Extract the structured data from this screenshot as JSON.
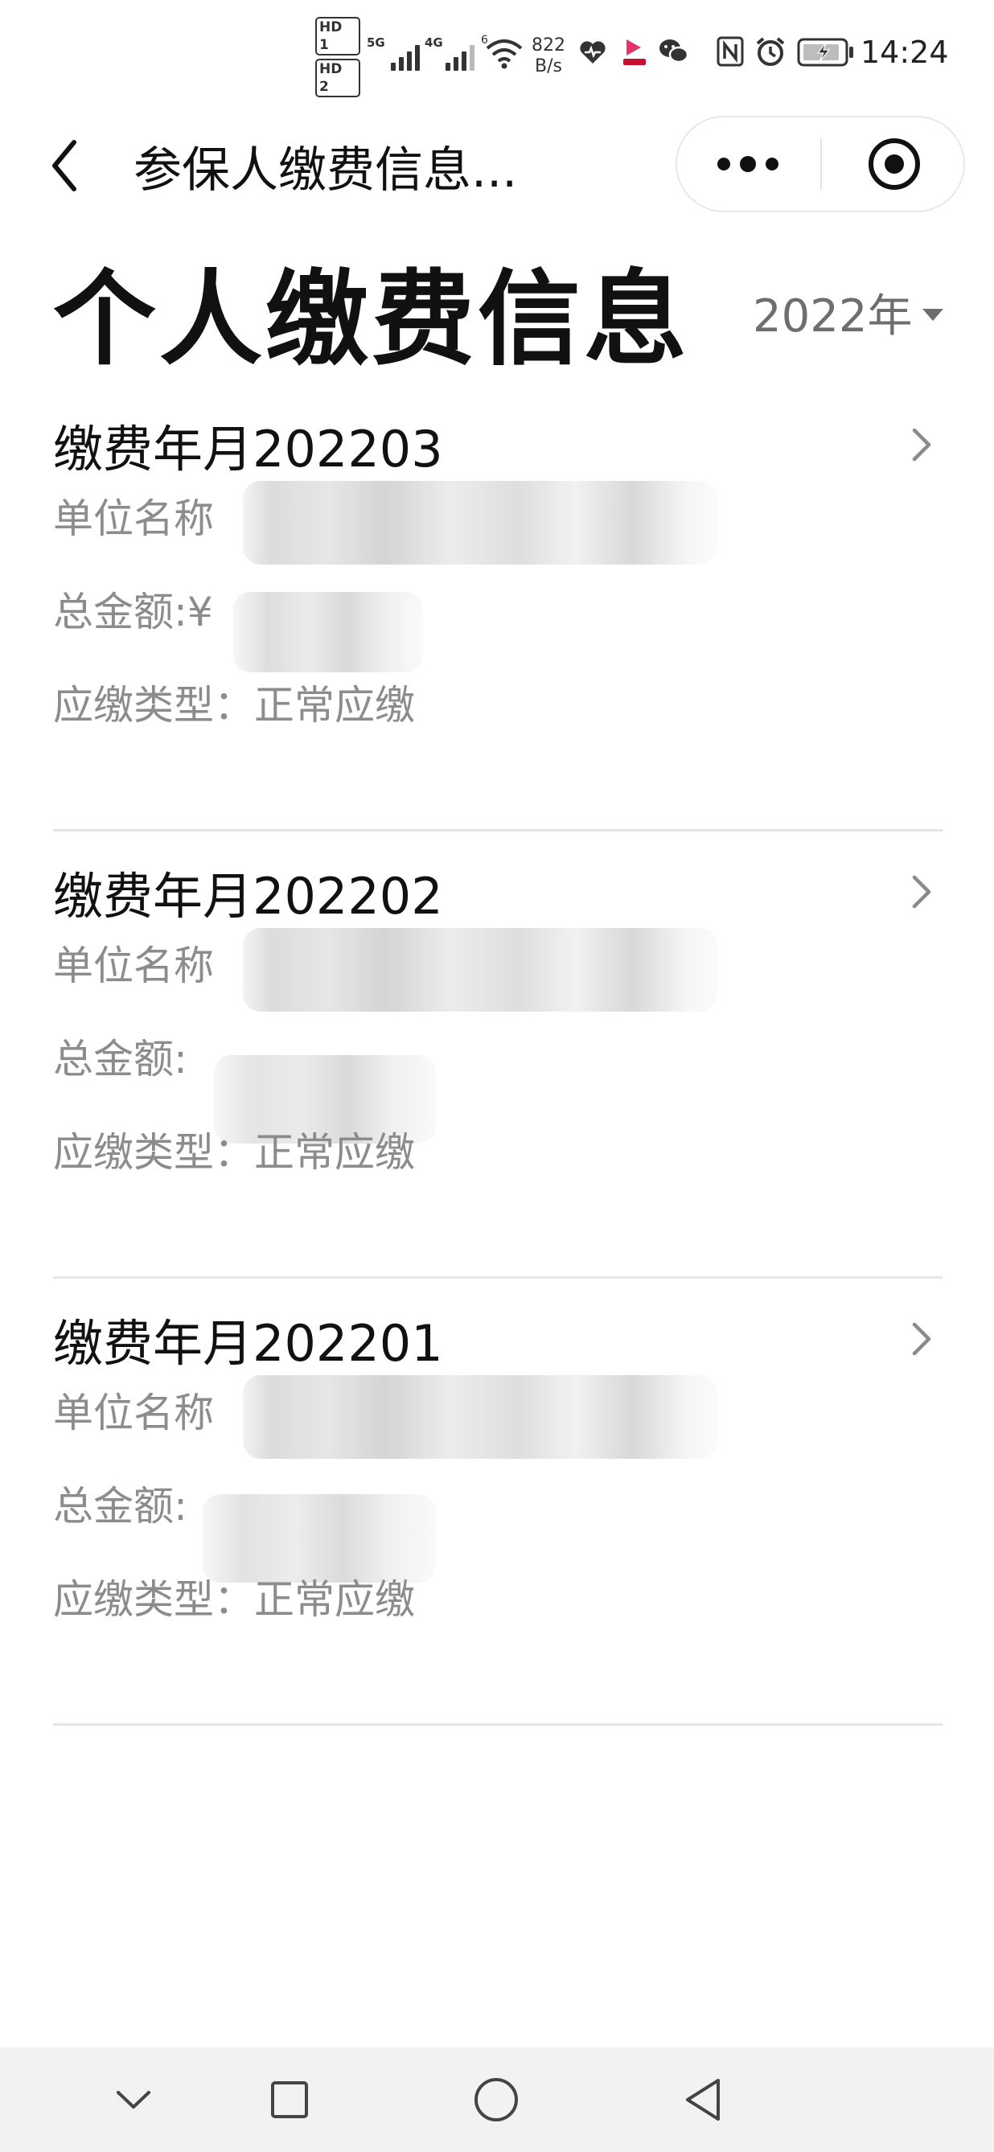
{
  "status_bar": {
    "hd_badges": [
      "HD 1",
      "HD 2"
    ],
    "network_1": "5G",
    "network_2": "4G",
    "wifi_sub": "6",
    "speed_value": "822",
    "speed_unit": "B/s",
    "time": "14:24",
    "icons": [
      "hd-icon",
      "signal-icon",
      "wifi-icon",
      "heart-health-icon",
      "app-badge-icon",
      "wechat-icon",
      "nfc-icon",
      "alarm-icon",
      "battery-charging-icon"
    ]
  },
  "nav": {
    "title": "参保人缴费信息...",
    "icons": [
      "back-arrow-icon",
      "more-dots-icon",
      "close-target-icon"
    ]
  },
  "header": {
    "title": "个人缴费信息",
    "year": "2022年"
  },
  "records": [
    {
      "title": "缴费年月202203",
      "company_label": "单位名称",
      "amount_label": "总金额:¥",
      "type_label": "应缴类型：正常应缴"
    },
    {
      "title": "缴费年月202202",
      "company_label": "单位名称",
      "amount_label": "总金额:",
      "type_label": "应缴类型：正常应缴"
    },
    {
      "title": "缴费年月202201",
      "company_label": "单位名称",
      "amount_label": "总金额:",
      "type_label": "应缴类型：正常应缴"
    }
  ],
  "colors": {
    "primary_text": "#111111",
    "secondary_text": "#8c8c8c",
    "divider": "#e5e5e5",
    "sys_nav_bg": "#f2f2f2"
  },
  "system_nav": {
    "icons": [
      "collapse-chevron-icon",
      "recent-apps-square-icon",
      "home-circle-icon",
      "back-triangle-icon"
    ]
  }
}
